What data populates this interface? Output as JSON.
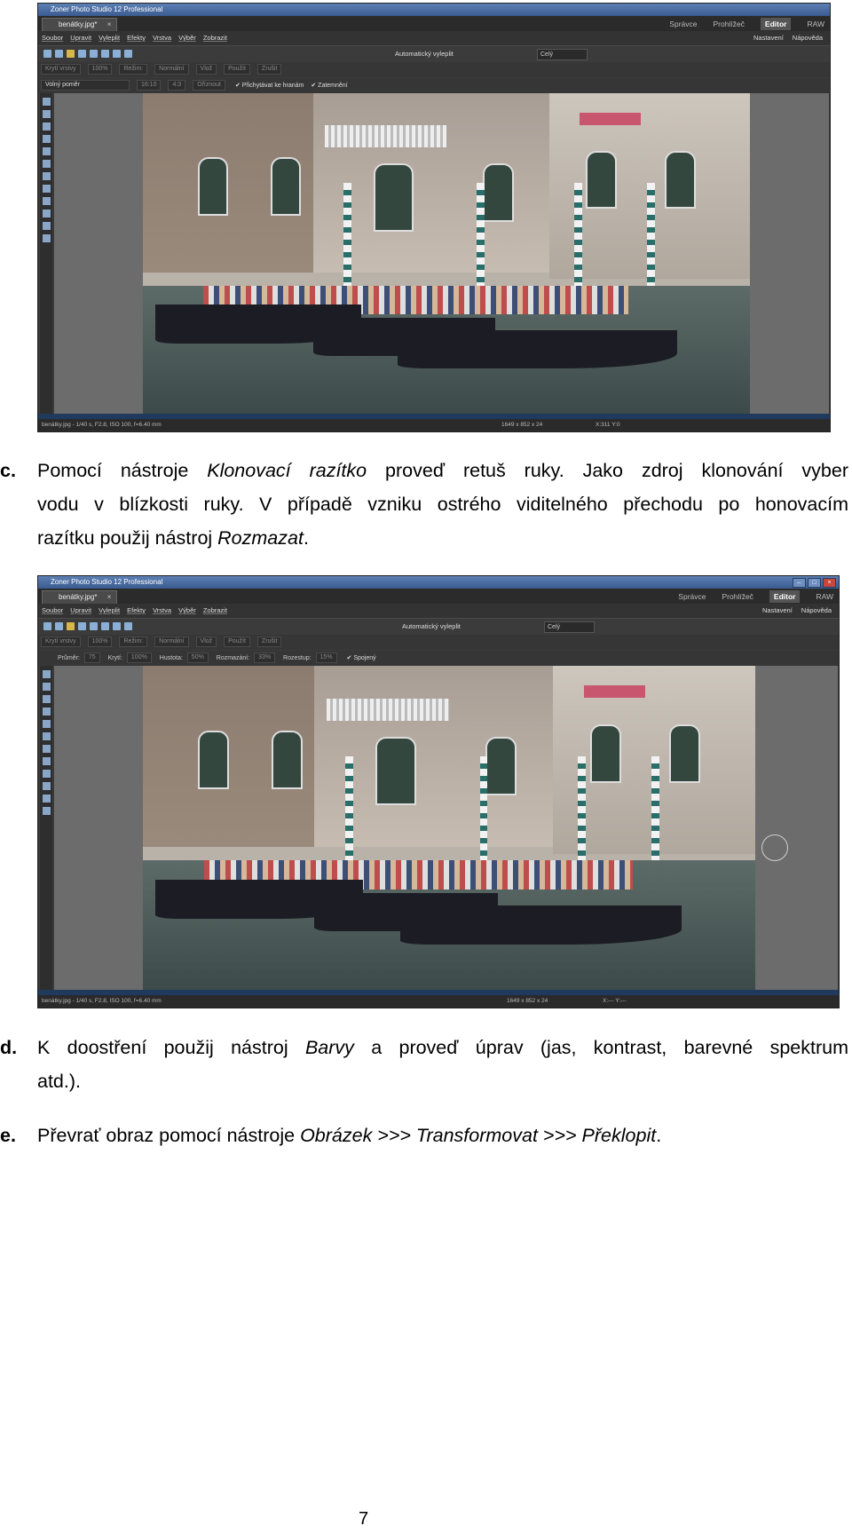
{
  "screenshot_top": {
    "app_title": "Zoner Photo Studio 12 Professional",
    "doc_tab": "benátky.jpg*",
    "modes": [
      "Správce",
      "Prohlížeč",
      "Editor",
      "RAW"
    ],
    "active_mode": "Editor",
    "menu": [
      "Soubor",
      "Upravit",
      "Vyleplit",
      "Efekty",
      "Vrstva",
      "Výběr",
      "Zobrazit"
    ],
    "menu_right": [
      "Nastavení",
      "Nápověda"
    ],
    "autofill_label": "Automatický vyleplit",
    "zoom_combo": "Celý",
    "opts1": [
      "Krytí vrstvy",
      "100%",
      "Režim:",
      "Normální",
      "Vlož",
      "Použít",
      "Zrušit"
    ],
    "opts2_ratio": "Volný poměr",
    "opts2_vals": [
      "16:10",
      "4:3"
    ],
    "opts2_crop": "Oříznout",
    "opts2_checks": [
      "Přichytávat ke hranám",
      "Zatemnění"
    ],
    "status_left": "benátky.jpg - 1/40 s, F2.8, ISO 100, f=6.40 mm",
    "status_mid": "1649 x 852 x 24",
    "status_right": "X:311  Y:0"
  },
  "para_c": {
    "marker": "c.",
    "line1_a": "Pomocí nástroje ",
    "line1_b": "Klonovací razítko",
    "line1_c": " proveď retuš ruky. Jako zdroj klonování vyber",
    "line2": "vodu v blízkosti ruky. V případě vzniku ostrého viditelného přechodu po honovacím",
    "line3_a": "razítku použij nástroj ",
    "line3_b": "Rozmazat",
    "line3_c": "."
  },
  "screenshot_bottom": {
    "app_title": "Zoner Photo Studio 12 Professional",
    "doc_tab": "benátky.jpg*",
    "modes": [
      "Správce",
      "Prohlížeč",
      "Editor",
      "RAW"
    ],
    "active_mode": "Editor",
    "menu": [
      "Soubor",
      "Upravit",
      "Vyleplit",
      "Efekty",
      "Vrstva",
      "Výběr",
      "Zobrazit"
    ],
    "menu_right": [
      "Nastavení",
      "Nápověda"
    ],
    "autofill_label": "Automatický vyleplit",
    "zoom_combo": "Celý",
    "opts1": [
      "Krytí vrstvy",
      "100%",
      "Režim:",
      "Normální",
      "Vlož",
      "Použít",
      "Zrušit"
    ],
    "brush_labels": [
      "Průměr:",
      "75",
      "Krytí:",
      "100%",
      "Hustota:",
      "50%",
      "Rozmazání:",
      "33%",
      "Rozestup:",
      "15%",
      "Spojený"
    ],
    "status_left": "benátky.jpg - 1/40 s, F2.8, ISO 100, f=6.40 mm",
    "status_mid": "1649 x 852 x 24",
    "status_right": "X:---  Y:---"
  },
  "para_d": {
    "marker": "d.",
    "line1_a": "K doostření použij nástroj ",
    "line1_b": "Barvy",
    "line1_c": " a proveď úprav (jas, kontrast, barevné spektrum",
    "line2": "atd.)."
  },
  "para_e": {
    "marker": "e.",
    "text_a": "Převrať obraz pomocí nástroje ",
    "text_b": "Obrázek >>> Transformovat >>> Překlopit",
    "text_c": "."
  },
  "page_number": "7"
}
